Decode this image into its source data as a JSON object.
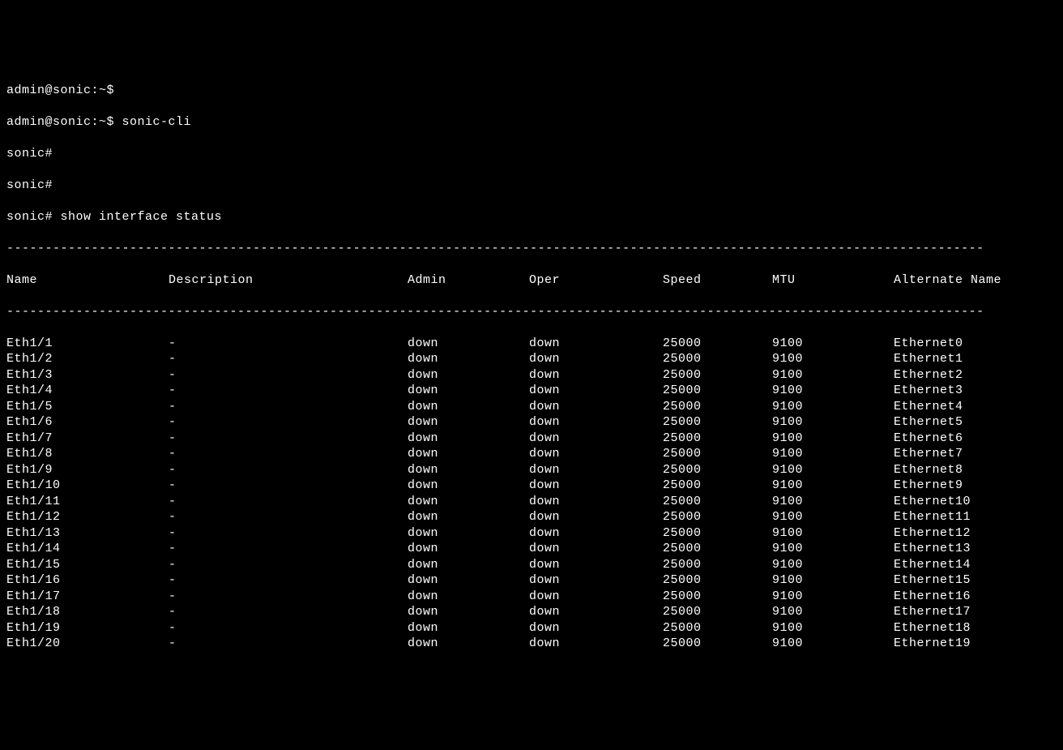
{
  "prompts": {
    "p1": "admin@sonic:~$",
    "p2": "admin@sonic:~$ sonic-cli",
    "p3": "sonic#",
    "p4": "sonic#",
    "p5": "sonic# show interface status"
  },
  "divider": "-------------------------------------------------------------------------------------------------------------------------------",
  "headers": {
    "name": "Name",
    "description": "Description",
    "admin": "Admin",
    "oper": "Oper",
    "speed": "Speed",
    "mtu": "MTU",
    "altname": "Alternate Name"
  },
  "rows": [
    {
      "name": "Eth1/1",
      "desc": "-",
      "admin": "down",
      "oper": "down",
      "speed": "25000",
      "mtu": "9100",
      "alt": "Ethernet0"
    },
    {
      "name": "Eth1/2",
      "desc": "-",
      "admin": "down",
      "oper": "down",
      "speed": "25000",
      "mtu": "9100",
      "alt": "Ethernet1"
    },
    {
      "name": "Eth1/3",
      "desc": "-",
      "admin": "down",
      "oper": "down",
      "speed": "25000",
      "mtu": "9100",
      "alt": "Ethernet2"
    },
    {
      "name": "Eth1/4",
      "desc": "-",
      "admin": "down",
      "oper": "down",
      "speed": "25000",
      "mtu": "9100",
      "alt": "Ethernet3"
    },
    {
      "name": "Eth1/5",
      "desc": "-",
      "admin": "down",
      "oper": "down",
      "speed": "25000",
      "mtu": "9100",
      "alt": "Ethernet4"
    },
    {
      "name": "Eth1/6",
      "desc": "-",
      "admin": "down",
      "oper": "down",
      "speed": "25000",
      "mtu": "9100",
      "alt": "Ethernet5"
    },
    {
      "name": "Eth1/7",
      "desc": "-",
      "admin": "down",
      "oper": "down",
      "speed": "25000",
      "mtu": "9100",
      "alt": "Ethernet6"
    },
    {
      "name": "Eth1/8",
      "desc": "-",
      "admin": "down",
      "oper": "down",
      "speed": "25000",
      "mtu": "9100",
      "alt": "Ethernet7"
    },
    {
      "name": "Eth1/9",
      "desc": "-",
      "admin": "down",
      "oper": "down",
      "speed": "25000",
      "mtu": "9100",
      "alt": "Ethernet8"
    },
    {
      "name": "Eth1/10",
      "desc": "-",
      "admin": "down",
      "oper": "down",
      "speed": "25000",
      "mtu": "9100",
      "alt": "Ethernet9"
    },
    {
      "name": "Eth1/11",
      "desc": "-",
      "admin": "down",
      "oper": "down",
      "speed": "25000",
      "mtu": "9100",
      "alt": "Ethernet10"
    },
    {
      "name": "Eth1/12",
      "desc": "-",
      "admin": "down",
      "oper": "down",
      "speed": "25000",
      "mtu": "9100",
      "alt": "Ethernet11"
    },
    {
      "name": "Eth1/13",
      "desc": "-",
      "admin": "down",
      "oper": "down",
      "speed": "25000",
      "mtu": "9100",
      "alt": "Ethernet12"
    },
    {
      "name": "Eth1/14",
      "desc": "-",
      "admin": "down",
      "oper": "down",
      "speed": "25000",
      "mtu": "9100",
      "alt": "Ethernet13"
    },
    {
      "name": "Eth1/15",
      "desc": "-",
      "admin": "down",
      "oper": "down",
      "speed": "25000",
      "mtu": "9100",
      "alt": "Ethernet14"
    },
    {
      "name": "Eth1/16",
      "desc": "-",
      "admin": "down",
      "oper": "down",
      "speed": "25000",
      "mtu": "9100",
      "alt": "Ethernet15"
    },
    {
      "name": "Eth1/17",
      "desc": "-",
      "admin": "down",
      "oper": "down",
      "speed": "25000",
      "mtu": "9100",
      "alt": "Ethernet16"
    },
    {
      "name": "Eth1/18",
      "desc": "-",
      "admin": "down",
      "oper": "down",
      "speed": "25000",
      "mtu": "9100",
      "alt": "Ethernet17"
    },
    {
      "name": "Eth1/19",
      "desc": "-",
      "admin": "down",
      "oper": "down",
      "speed": "25000",
      "mtu": "9100",
      "alt": "Ethernet18"
    },
    {
      "name": "Eth1/20",
      "desc": "-",
      "admin": "down",
      "oper": "down",
      "speed": "25000",
      "mtu": "9100",
      "alt": "Ethernet19"
    }
  ]
}
